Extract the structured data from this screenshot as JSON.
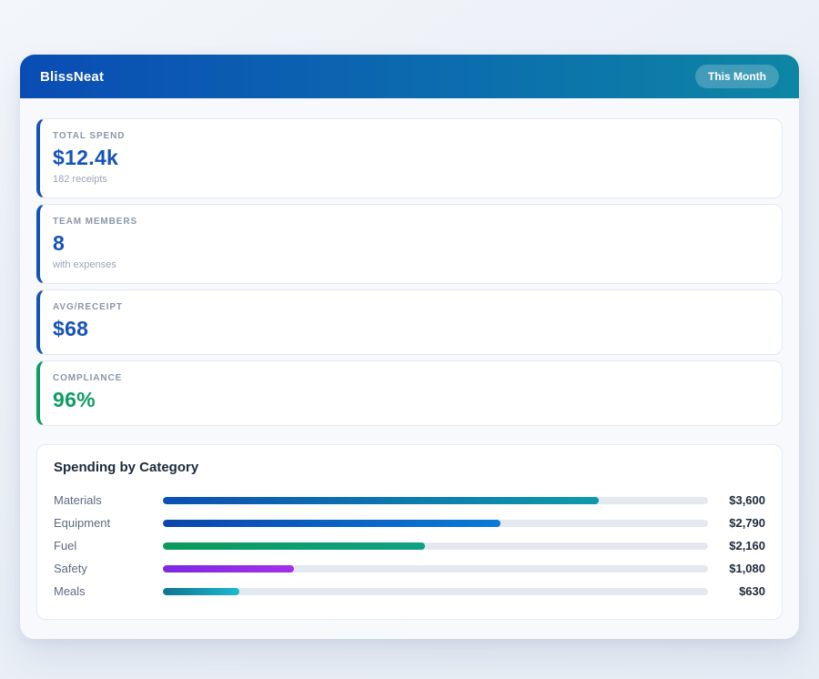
{
  "header": {
    "title": "BlissNeat",
    "badge": "This Month"
  },
  "stats": [
    {
      "label": "TOTAL SPEND",
      "value": "$12.4k",
      "sub": "182 receipts",
      "accent": "#1653b8",
      "value_color": "#1653b8"
    },
    {
      "label": "TEAM MEMBERS",
      "value": "8",
      "sub": "with expenses",
      "accent": "#1653b8",
      "value_color": "#1653b8"
    },
    {
      "label": "AVG/RECEIPT",
      "value": "$68",
      "sub": "",
      "accent": "#1653b8",
      "value_color": "#1653b8"
    },
    {
      "label": "COMPLIANCE",
      "value": "96%",
      "sub": "",
      "accent": "#0f9d63",
      "value_color": "#0f9d63"
    }
  ],
  "chart": {
    "title": "Spending by Category",
    "rows": [
      {
        "label": "Materials",
        "value": "$3,600",
        "pct": 80,
        "color_from": "#0b4fb3",
        "color_to": "#0f9aab"
      },
      {
        "label": "Equipment",
        "value": "$2,790",
        "pct": 62,
        "color_from": "#0b47ad",
        "color_to": "#0a7ad9"
      },
      {
        "label": "Fuel",
        "value": "$2,160",
        "pct": 48,
        "color_from": "#0a9b57",
        "color_to": "#11a086"
      },
      {
        "label": "Safety",
        "value": "$1,080",
        "pct": 24,
        "color_from": "#7b2ae1",
        "color_to": "#a42ee9"
      },
      {
        "label": "Meals",
        "value": "$630",
        "pct": 14,
        "color_from": "#0e7490",
        "color_to": "#1cb9d0"
      }
    ]
  },
  "chart_data": {
    "type": "bar",
    "orientation": "horizontal",
    "title": "Spending by Category",
    "categories": [
      "Materials",
      "Equipment",
      "Fuel",
      "Safety",
      "Meals"
    ],
    "values": [
      3600,
      2790,
      2160,
      1080,
      630
    ],
    "value_labels": [
      "$3,600",
      "$2,790",
      "$2,160",
      "$1,080",
      "$630"
    ],
    "xlim": [
      0,
      4500
    ],
    "grid": false,
    "legend": false
  }
}
